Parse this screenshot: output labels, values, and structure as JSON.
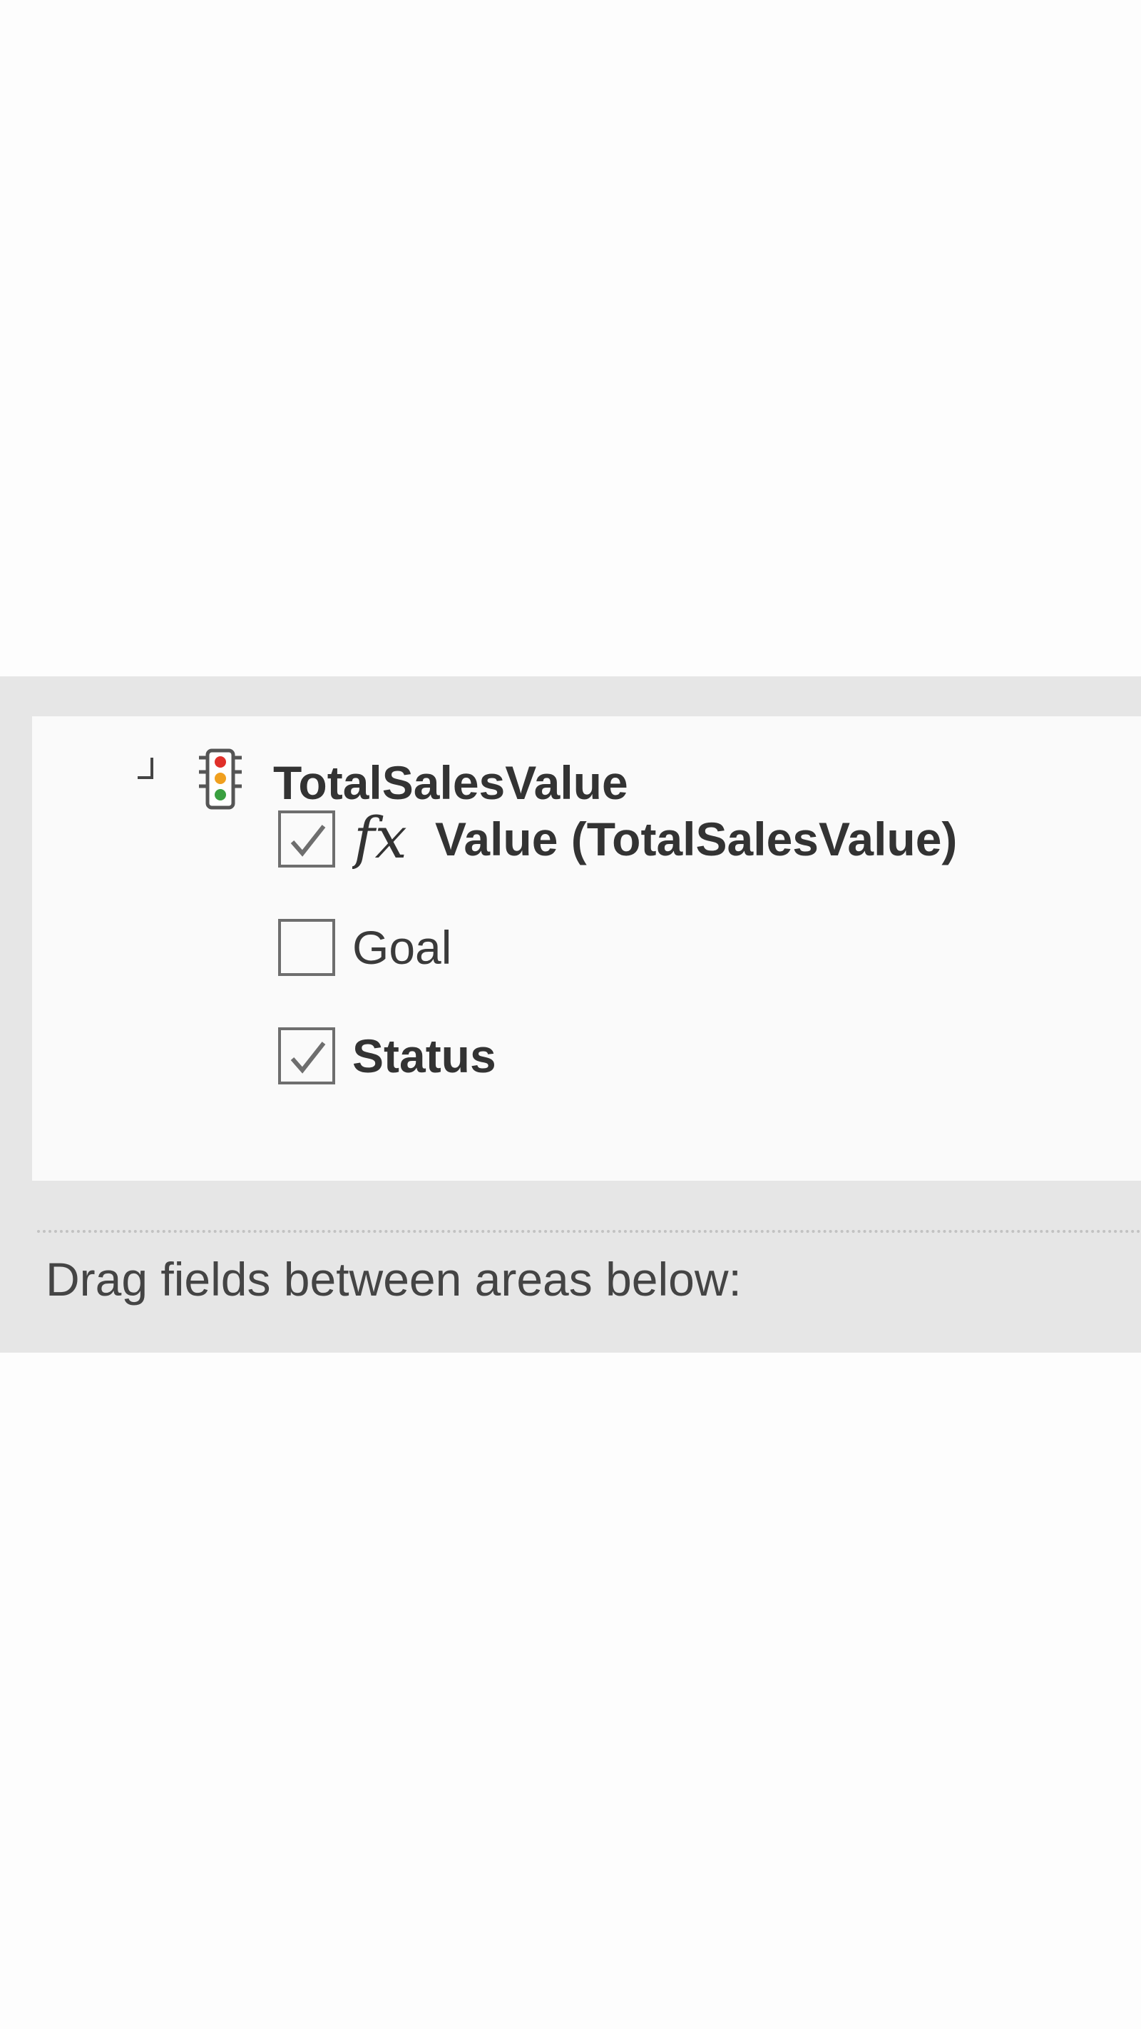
{
  "field_list": {
    "kpi": {
      "name": "TotalSalesValue",
      "icon": "kpi-traffic-light-icon",
      "items": [
        {
          "label": "Value (TotalSalesValue)",
          "checked": true,
          "icon": "fx-formula-icon",
          "bold": true
        },
        {
          "label": "Goal",
          "checked": false,
          "bold": false
        },
        {
          "label": "Status",
          "checked": true,
          "bold": true
        }
      ]
    }
  },
  "drag_hint": "Drag fields between areas below:",
  "colors": {
    "panel_background": "#e6e6e6",
    "list_background": "#fafafa",
    "text": "#333333",
    "checkbox_border": "#6e6e6e",
    "traffic_light_red": "#e0302a",
    "traffic_light_yellow": "#f0a020",
    "traffic_light_green": "#3aa040"
  }
}
